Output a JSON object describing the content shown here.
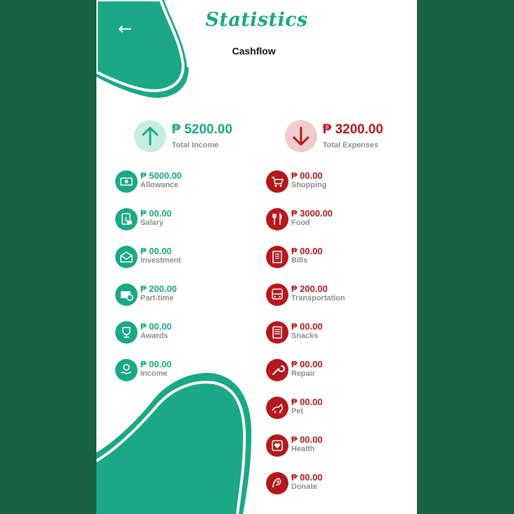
{
  "header": {
    "back_icon": "arrow-left-icon",
    "back_glyph": "←",
    "title": "Statistics",
    "subtitle": "Cashflow"
  },
  "summary": {
    "income": {
      "amount": "₱ 5200.00",
      "label": "Total Income",
      "icon": "arrow-up-icon"
    },
    "expenses": {
      "amount": "₱ 3200.00",
      "label": "Total Expenses",
      "icon": "arrow-down-icon"
    }
  },
  "income_items": [
    {
      "amount": "₱  5000.00",
      "label": "Allowance",
      "icon": "money-icon"
    },
    {
      "amount": "₱  00.00",
      "label": "Salary",
      "icon": "salary-icon"
    },
    {
      "amount": "₱  00.00",
      "label": "Investment",
      "icon": "investment-icon"
    },
    {
      "amount": "₱  200.00",
      "label": "Part-time",
      "icon": "part-time-icon"
    },
    {
      "amount": "₱  00.00",
      "label": "Awards",
      "icon": "trophy-icon"
    },
    {
      "amount": "₱  00.00",
      "label": "Income",
      "icon": "hand-coin-icon"
    }
  ],
  "expense_items": [
    {
      "amount": "₱  00.00",
      "label": "Shopping",
      "icon": "cart-icon"
    },
    {
      "amount": "₱  3000.00",
      "label": "Food",
      "icon": "utensils-icon"
    },
    {
      "amount": "₱  00.00",
      "label": "Bills",
      "icon": "bill-icon"
    },
    {
      "amount": "₱  200.00",
      "label": "Transportation",
      "icon": "bus-icon"
    },
    {
      "amount": "₱  00.00",
      "label": "Snacks",
      "icon": "snacks-icon"
    },
    {
      "amount": "₱  00.00",
      "label": "Repair",
      "icon": "wrench-icon"
    },
    {
      "amount": "₱  00.00",
      "label": "Pet",
      "icon": "pet-icon"
    },
    {
      "amount": "₱  00.00",
      "label": "Health",
      "icon": "heart-icon"
    },
    {
      "amount": "₱  00.00",
      "label": "Donate",
      "icon": "donate-icon"
    }
  ],
  "colors": {
    "background": "#186243",
    "income": "#1aa886",
    "expense": "#b3181c",
    "muted": "#8a8f8d"
  }
}
